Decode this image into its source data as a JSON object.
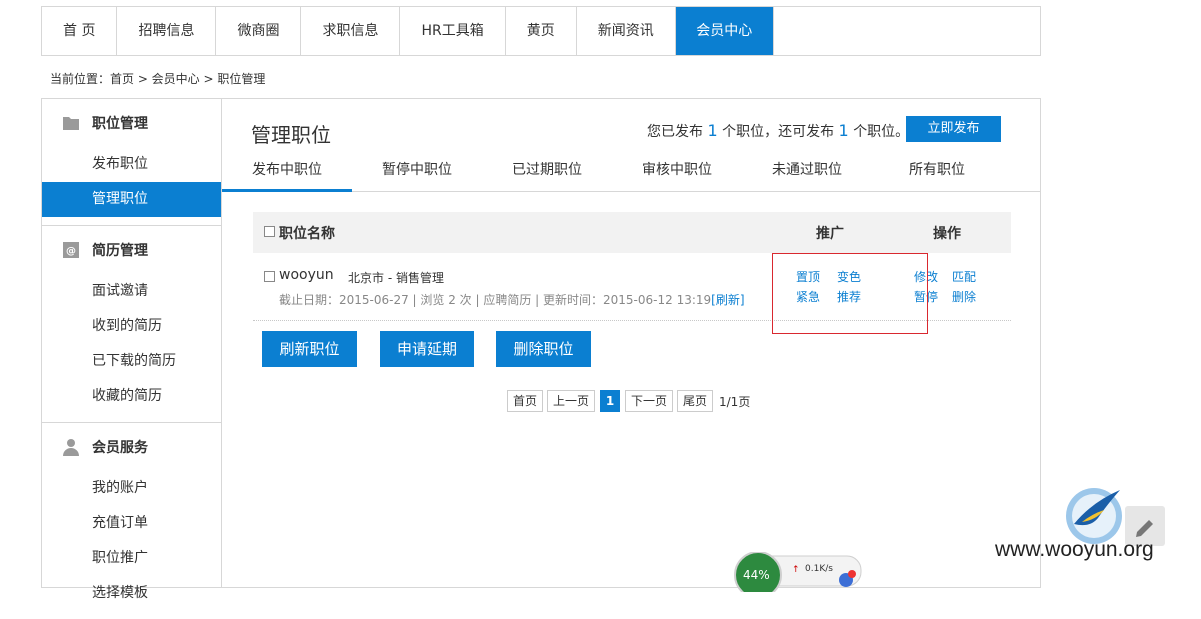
{
  "nav": {
    "items": [
      "首 页",
      "招聘信息",
      "微商圈",
      "求职信息",
      "HR工具箱",
      "黄页",
      "新闻资讯",
      "会员中心"
    ],
    "active": "会员中心"
  },
  "breadcrumb": "当前位置：首页 > 会员中心 > 职位管理",
  "sidebar": {
    "sections": [
      {
        "title": "职位管理",
        "icon": "folder-icon",
        "items": [
          "发布职位",
          "管理职位"
        ]
      },
      {
        "title": "简历管理",
        "icon": "resume-icon",
        "items": [
          "面试邀请",
          "收到的简历",
          "已下载的简历",
          "收藏的简历"
        ]
      },
      {
        "title": "会员服务",
        "icon": "user-icon",
        "items": [
          "我的账户",
          "充值订单",
          "职位推广",
          "选择模板"
        ]
      }
    ],
    "active_item": "管理职位"
  },
  "main": {
    "title": "管理职位",
    "stat": {
      "prefix": "您已发布",
      "published": "1",
      "mid": "个职位，还可发布",
      "remaining": "1",
      "suffix": "个职位。"
    },
    "publish_button": "立即发布",
    "tabs": [
      "发布中职位",
      "暂停中职位",
      "已过期职位",
      "审核中职位",
      "未通过职位",
      "所有职位"
    ],
    "active_tab": "发布中职位"
  },
  "table": {
    "headers": {
      "name": "职位名称",
      "promotion": "推广",
      "operation": "操作"
    },
    "rows": [
      {
        "title": "wooyun",
        "location": "北京市 - 销售管理",
        "meta": "截止日期：2015-06-27 | 浏览 2 次 | 应聘简历 | 更新时间：2015-06-12 13:19",
        "refresh_link": "[刷新]",
        "promo_actions": [
          "置顶",
          "变色",
          "紧急",
          "推荐"
        ],
        "op_actions": [
          "修改",
          "匹配",
          "暂停",
          "删除"
        ]
      }
    ]
  },
  "buttons": {
    "refresh": "刷新职位",
    "extend": "申请延期",
    "delete": "删除职位"
  },
  "pagination": {
    "first": "首页",
    "prev": "上一页",
    "current": "1",
    "next": "下一页",
    "last": "尾页",
    "info": "1/1页"
  },
  "widgets": {
    "speed_percent": "44%",
    "speed_rate": "0.1K/s",
    "watermark": "www.wooyun.org"
  },
  "colors": {
    "accent": "#0b7fd1",
    "highlight_box": "#d9282f"
  }
}
